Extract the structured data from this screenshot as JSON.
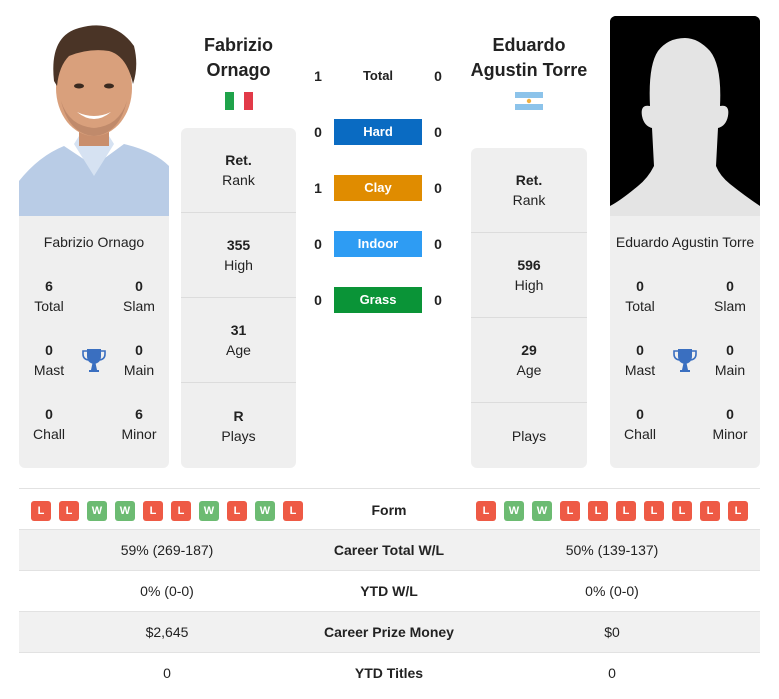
{
  "player1": {
    "name_heading_line1": "Fabrizio",
    "name_heading_line2": "Ornago",
    "full_name": "Fabrizio Ornago",
    "country_flag": "italy-flag",
    "photo": "player-photo",
    "rank": {
      "value": "Ret.",
      "label": "Rank"
    },
    "high": {
      "value": "355",
      "label": "High"
    },
    "age": {
      "value": "31",
      "label": "Age"
    },
    "plays": {
      "value": "R",
      "label": "Plays"
    },
    "titles": {
      "total": {
        "value": "6",
        "label": "Total"
      },
      "slam": {
        "value": "0",
        "label": "Slam"
      },
      "mast": {
        "value": "0",
        "label": "Mast"
      },
      "main": {
        "value": "0",
        "label": "Main"
      },
      "chall": {
        "value": "0",
        "label": "Chall"
      },
      "minor": {
        "value": "6",
        "label": "Minor"
      }
    },
    "form": [
      "L",
      "L",
      "W",
      "W",
      "L",
      "L",
      "W",
      "L",
      "W",
      "L"
    ]
  },
  "player2": {
    "name_heading_line1": "Eduardo",
    "name_heading_line2": "Agustin Torre",
    "full_name": "Eduardo Agustin Torre",
    "country_flag": "argentina-flag",
    "photo": "silhouette-placeholder",
    "rank": {
      "value": "Ret.",
      "label": "Rank"
    },
    "high": {
      "value": "596",
      "label": "High"
    },
    "age": {
      "value": "29",
      "label": "Age"
    },
    "plays": {
      "value": "",
      "label": "Plays"
    },
    "titles": {
      "total": {
        "value": "0",
        "label": "Total"
      },
      "slam": {
        "value": "0",
        "label": "Slam"
      },
      "mast": {
        "value": "0",
        "label": "Mast"
      },
      "main": {
        "value": "0",
        "label": "Main"
      },
      "chall": {
        "value": "0",
        "label": "Chall"
      },
      "minor": {
        "value": "0",
        "label": "Minor"
      }
    },
    "form": [
      "L",
      "W",
      "W",
      "L",
      "L",
      "L",
      "L",
      "L",
      "L",
      "L"
    ]
  },
  "h2h": {
    "total": {
      "label": "Total",
      "p1": "1",
      "p2": "0"
    },
    "surfaces": [
      {
        "label": "Hard",
        "p1": "0",
        "p2": "0",
        "color": "#0a6bc2"
      },
      {
        "label": "Clay",
        "p1": "1",
        "p2": "0",
        "color": "#e08c00"
      },
      {
        "label": "Indoor",
        "p1": "0",
        "p2": "0",
        "color": "#2e9cf3"
      },
      {
        "label": "Grass",
        "p1": "0",
        "p2": "0",
        "color": "#0a9437"
      }
    ]
  },
  "form_label": "Form",
  "stats": [
    {
      "label": "Career Total W/L",
      "p1": "59% (269-187)",
      "p2": "50% (139-137)"
    },
    {
      "label": "YTD W/L",
      "p1": "0% (0-0)",
      "p2": "0% (0-0)"
    },
    {
      "label": "Career Prize Money",
      "p1": "$2,645",
      "p2": "$0"
    },
    {
      "label": "YTD Titles",
      "p1": "0",
      "p2": "0"
    }
  ],
  "colors": {
    "loss": "#ee5a45",
    "win": "#6cbb72",
    "trophy": "#3a6fc0",
    "card_bg": "#efefef"
  }
}
